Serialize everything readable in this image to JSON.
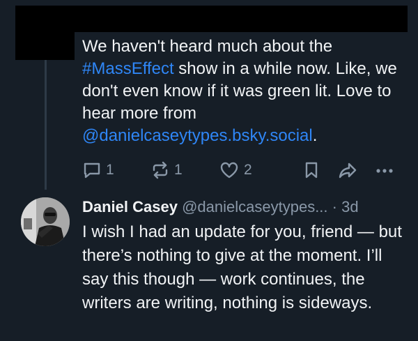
{
  "post": {
    "text_1": "We haven't heard much about the ",
    "hashtag": "#MassEffect",
    "text_2": " show in a while now. Like, we don't even know if it was green lit. Love to hear more from ",
    "mention": "@danielcaseytypes.bsky.social",
    "text_3": ".",
    "reply_count": "1",
    "repost_count": "1",
    "like_count": "2"
  },
  "reply": {
    "author_name": "Daniel Casey",
    "author_handle": "@danielcaseytypes...",
    "separator": " · ",
    "time": "3d",
    "text": "I wish I had an update for you, friend — but there’s nothing to give at the moment. I’ll say this though — work continues, the writers are writing, nothing is sideways."
  },
  "colors": {
    "background": "#161e27",
    "link": "#2f86f6",
    "muted": "#8a98a8",
    "text": "#f1f3f5"
  },
  "icons": [
    "reply-icon",
    "repost-icon",
    "like-icon",
    "bookmark-icon",
    "share-icon",
    "more-icon"
  ]
}
